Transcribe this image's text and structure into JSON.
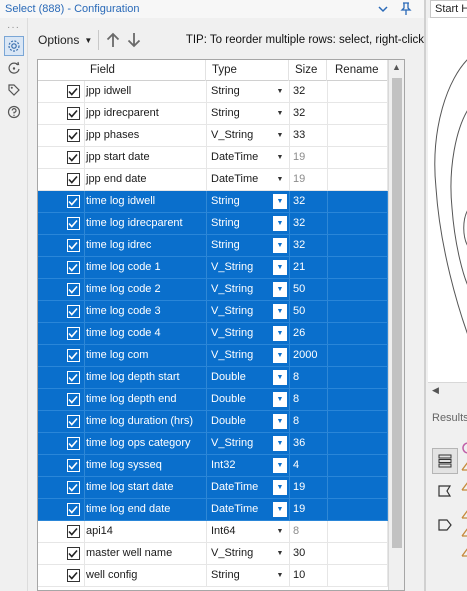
{
  "title": "Select (888) - Configuration",
  "toolbar": {
    "options_label": "Options",
    "tip": "TIP: To reorder multiple rows: select, right-click"
  },
  "grid": {
    "columns": [
      "Field",
      "Type",
      "Size",
      "Rename"
    ],
    "rows": [
      {
        "field": "jpp idwell",
        "type": "String",
        "size": "32",
        "selected": false,
        "dim": false
      },
      {
        "field": "jpp idrecparent",
        "type": "String",
        "size": "32",
        "selected": false,
        "dim": false
      },
      {
        "field": "jpp phases",
        "type": "V_String",
        "size": "33",
        "selected": false,
        "dim": false
      },
      {
        "field": "jpp start date",
        "type": "DateTime",
        "size": "19",
        "selected": false,
        "dim": true
      },
      {
        "field": "jpp end date",
        "type": "DateTime",
        "size": "19",
        "selected": false,
        "dim": true
      },
      {
        "field": "time log idwell",
        "type": "String",
        "size": "32",
        "selected": true,
        "dim": false
      },
      {
        "field": "time log idrecparent",
        "type": "String",
        "size": "32",
        "selected": true,
        "dim": false
      },
      {
        "field": "time log idrec",
        "type": "String",
        "size": "32",
        "selected": true,
        "dim": false
      },
      {
        "field": "time log code 1",
        "type": "V_String",
        "size": "21",
        "selected": true,
        "dim": false
      },
      {
        "field": "time log code 2",
        "type": "V_String",
        "size": "50",
        "selected": true,
        "dim": false
      },
      {
        "field": "time log code 3",
        "type": "V_String",
        "size": "50",
        "selected": true,
        "dim": false
      },
      {
        "field": "time log code 4",
        "type": "V_String",
        "size": "26",
        "selected": true,
        "dim": false
      },
      {
        "field": "time log com",
        "type": "V_String",
        "size": "2000",
        "selected": true,
        "dim": false
      },
      {
        "field": "time log depth start",
        "type": "Double",
        "size": "8",
        "selected": true,
        "dim": false
      },
      {
        "field": "time log depth end",
        "type": "Double",
        "size": "8",
        "selected": true,
        "dim": false
      },
      {
        "field": "time log duration (hrs)",
        "type": "Double",
        "size": "8",
        "selected": true,
        "dim": false
      },
      {
        "field": "time log ops category",
        "type": "V_String",
        "size": "36",
        "selected": true,
        "dim": false
      },
      {
        "field": "time log sysseq",
        "type": "Int32",
        "size": "4",
        "selected": true,
        "dim": false
      },
      {
        "field": "time log start date",
        "type": "DateTime",
        "size": "19",
        "selected": true,
        "dim": false
      },
      {
        "field": "time log end date",
        "type": "DateTime",
        "size": "19",
        "selected": true,
        "dim": false
      },
      {
        "field": "api14",
        "type": "Int64",
        "size": "8",
        "selected": false,
        "dim": true
      },
      {
        "field": "master well name",
        "type": "V_String",
        "size": "30",
        "selected": false,
        "dim": false
      },
      {
        "field": "well config",
        "type": "String",
        "size": "10",
        "selected": false,
        "dim": false
      }
    ]
  },
  "right_panel": {
    "start_tab": "Start H",
    "results_label": "Results"
  },
  "colors": {
    "selection": "#0a6fcc",
    "accent": "#2a6ab8"
  },
  "icons": {
    "rail": [
      "gear-icon",
      "rotate-icon",
      "tag-icon",
      "help-icon"
    ],
    "results_tools": [
      "list-icon",
      "ribbon-icon",
      "tag-shape-icon"
    ]
  }
}
